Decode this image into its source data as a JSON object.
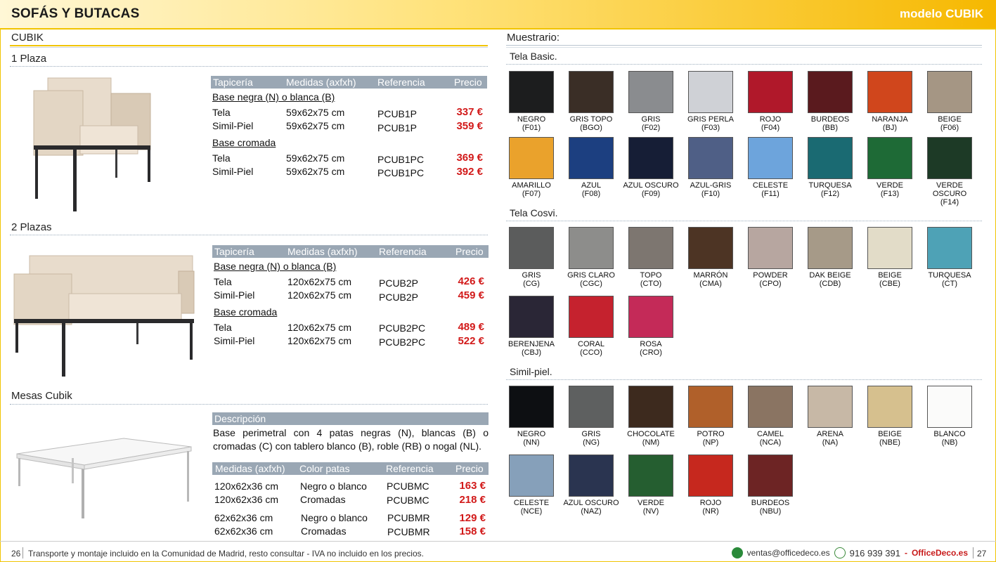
{
  "header": {
    "title": "SOFÁS Y BUTACAS",
    "model": "modelo CUBIK"
  },
  "left": {
    "section_title": "CUBIK",
    "plaza1": {
      "title": "1 Plaza",
      "headers": [
        "Tapicería",
        "Medidas (axfxh)",
        "Referencia",
        "Precio"
      ],
      "group1": "Base negra (N) o blanca (B)",
      "rows1": [
        {
          "tap": "Tela",
          "med": "59x62x75 cm",
          "ref": "PCUB1P",
          "price": "337 €"
        },
        {
          "tap": "Simil-Piel",
          "med": "59x62x75 cm",
          "ref": "PCUB1P",
          "price": "359 €"
        }
      ],
      "group2": "Base cromada",
      "rows2": [
        {
          "tap": "Tela",
          "med": "59x62x75 cm",
          "ref": "PCUB1PC",
          "price": "369 €"
        },
        {
          "tap": "Simil-Piel",
          "med": "59x62x75 cm",
          "ref": "PCUB1PC",
          "price": "392 €"
        }
      ]
    },
    "plaza2": {
      "title": "2 Plazas",
      "headers": [
        "Tapicería",
        "Medidas (axfxh)",
        "Referencia",
        "Precio"
      ],
      "group1": "Base negra (N) o blanca (B)",
      "rows1": [
        {
          "tap": "Tela",
          "med": "120x62x75 cm",
          "ref": "PCUB2P",
          "price": "426 €"
        },
        {
          "tap": "Simil-Piel",
          "med": "120x62x75 cm",
          "ref": "PCUB2P",
          "price": "459 €"
        }
      ],
      "group2": "Base cromada",
      "rows2": [
        {
          "tap": "Tela",
          "med": "120x62x75 cm",
          "ref": "PCUB2PC",
          "price": "489 €"
        },
        {
          "tap": "Simil-Piel",
          "med": "120x62x75 cm",
          "ref": "PCUB2PC",
          "price": "522 €"
        }
      ]
    },
    "mesas": {
      "title": "Mesas Cubik",
      "desc_header": "Descripción",
      "description": "Base perimetral con 4 patas negras (N), blancas (B) o cromadas (C) con tablero blanco (B), roble (RB) o nogal (NL).",
      "headers": [
        "Medidas (axfxh)",
        "Color patas",
        "Referencia",
        "Precio"
      ],
      "rows": [
        {
          "med": "120x62x36 cm",
          "color": "Negro o blanco",
          "ref": "PCUBMC",
          "price": "163 €"
        },
        {
          "med": "120x62x36 cm",
          "color": "Cromadas",
          "ref": "PCUBMC",
          "price": "218 €"
        },
        {
          "med": "62x62x36 cm",
          "color": "Negro o blanco",
          "ref": "PCUBMR",
          "price": "129 €"
        },
        {
          "med": "62x62x36 cm",
          "color": "Cromadas",
          "ref": "PCUBMR",
          "price": "158 €"
        }
      ]
    }
  },
  "right": {
    "title": "Muestrario:",
    "basic": {
      "title": "Tela Basic.",
      "items": [
        {
          "name": "NEGRO",
          "code": "(F01)",
          "color": "#1c1d1e"
        },
        {
          "name": "GRIS TOPO",
          "code": "(BGO)",
          "color": "#3a2e26"
        },
        {
          "name": "GRIS",
          "code": "(F02)",
          "color": "#8a8c8f"
        },
        {
          "name": "GRIS PERLA",
          "code": "(F03)",
          "color": "#cfd1d6"
        },
        {
          "name": "ROJO",
          "code": "(F04)",
          "color": "#b0182a"
        },
        {
          "name": "BURDEOS",
          "code": "(BB)",
          "color": "#5a1a1e"
        },
        {
          "name": "NARANJA",
          "code": "(BJ)",
          "color": "#d0461c"
        },
        {
          "name": "BEIGE",
          "code": "(F06)",
          "color": "#a59684"
        },
        {
          "name": "AMARILLO",
          "code": "(F07)",
          "color": "#eaa22c"
        },
        {
          "name": "AZUL",
          "code": "(F08)",
          "color": "#1c3f80"
        },
        {
          "name": "AZUL OSCURO",
          "code": "(F09)",
          "color": "#161e36"
        },
        {
          "name": "AZUL-GRIS",
          "code": "(F10)",
          "color": "#4f5f86"
        },
        {
          "name": "CELESTE",
          "code": "(F11)",
          "color": "#6da4dc"
        },
        {
          "name": "TURQUESA",
          "code": "(F12)",
          "color": "#1a6a72"
        },
        {
          "name": "VERDE",
          "code": "(F13)",
          "color": "#1e6a36"
        },
        {
          "name": "VERDE OSCURO",
          "code": "(F14)",
          "color": "#1d3a26"
        }
      ]
    },
    "cosvi": {
      "title": "Tela Cosvi.",
      "items": [
        {
          "name": "GRIS",
          "code": "(CG)",
          "color": "#5b5c5c"
        },
        {
          "name": "GRIS CLARO",
          "code": "(CGC)",
          "color": "#8d8d8b"
        },
        {
          "name": "TOPO",
          "code": "(CTO)",
          "color": "#7d7670"
        },
        {
          "name": "MARRÓN",
          "code": "(CMA)",
          "color": "#4d3424"
        },
        {
          "name": "POWDER",
          "code": "(CPO)",
          "color": "#b7a6a0"
        },
        {
          "name": "DAK BEIGE",
          "code": "(CDB)",
          "color": "#a69a88"
        },
        {
          "name": "BEIGE",
          "code": "(CBE)",
          "color": "#e2dcc8"
        },
        {
          "name": "TURQUESA",
          "code": "(CT)",
          "color": "#4ea2b6"
        },
        {
          "name": "BERENJENA",
          "code": "(CBJ)",
          "color": "#2a2636"
        },
        {
          "name": "CORAL",
          "code": "(CCO)",
          "color": "#c5222e"
        },
        {
          "name": "ROSA",
          "code": "(CRO)",
          "color": "#c42a58"
        }
      ]
    },
    "simil": {
      "title": "Simil-piel.",
      "items": [
        {
          "name": "NEGRO",
          "code": "(NN)",
          "color": "#0d0f12"
        },
        {
          "name": "GRIS",
          "code": "(NG)",
          "color": "#5e6060"
        },
        {
          "name": "CHOCOLATE",
          "code": "(NM)",
          "color": "#3d2a1e"
        },
        {
          "name": "POTRO",
          "code": "(NP)",
          "color": "#b0602a"
        },
        {
          "name": "CAMEL",
          "code": "(NCA)",
          "color": "#8a7462"
        },
        {
          "name": "ARENA",
          "code": "(NA)",
          "color": "#c7b8a6"
        },
        {
          "name": "BEIGE",
          "code": "(NBE)",
          "color": "#d6c08e"
        },
        {
          "name": "BLANCO",
          "code": "(NB)",
          "color": "#fbfbfa"
        },
        {
          "name": "CELESTE",
          "code": "(NCE)",
          "color": "#86a0ba"
        },
        {
          "name": "AZUL OSCURO",
          "code": "(NAZ)",
          "color": "#2a3450"
        },
        {
          "name": "VERDE",
          "code": "(NV)",
          "color": "#255e30"
        },
        {
          "name": "ROJO",
          "code": "(NR)",
          "color": "#c6281e"
        },
        {
          "name": "BURDEOS",
          "code": "(NBU)",
          "color": "#6d2424"
        }
      ]
    }
  },
  "footer": {
    "page_left": "26",
    "text": "Transporte y montaje incluido en la Comunidad de Madrid, resto consultar - IVA no incluido en los precios.",
    "email": "ventas@officedeco.es",
    "phone": "916 939 391",
    "sep": "-",
    "brand": "OfficeDeco.es",
    "page_right": "27"
  }
}
